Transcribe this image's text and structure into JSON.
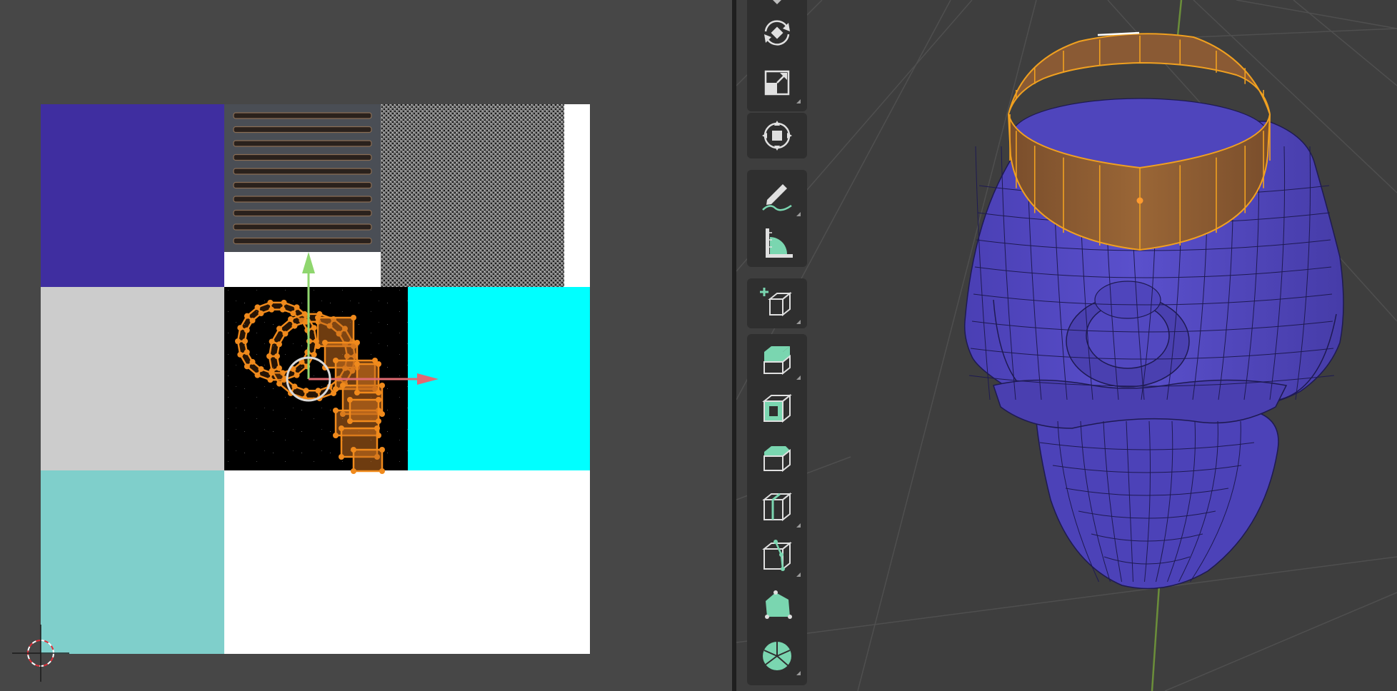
{
  "uv_editor": {
    "background": "#474747",
    "texture_tiles": [
      {
        "name": "uv-tile-purple",
        "color": "#3f2ea0"
      },
      {
        "name": "uv-tile-vent",
        "color": "#4a4e55"
      },
      {
        "name": "uv-tile-noise",
        "color": "#8a8a8a"
      },
      {
        "name": "uv-tile-gray",
        "color": "#cccccc"
      },
      {
        "name": "uv-tile-black",
        "color": "#000000"
      },
      {
        "name": "uv-tile-cyan",
        "color": "#00ffff"
      },
      {
        "name": "uv-tile-teal",
        "color": "#7fcfcb"
      },
      {
        "name": "uv-tile-white",
        "color": "#ffffff"
      }
    ],
    "selection_color": "#f08a1c",
    "gizmo": {
      "x_axis_color": "#e06a72",
      "y_axis_color": "#8fd66e",
      "pivot_color": "#d9d9d9"
    },
    "cursor_icon": "2d-cursor-icon"
  },
  "viewport": {
    "background": "#3e3e3e",
    "mesh_color": "#5248c0",
    "selected_face_color": "#8a5a34",
    "selected_edge_color": "#f0a020",
    "active_edge_color": "#ffffff",
    "origin_color": "#ff9a2e",
    "z_axis_color": "#6b8e3a"
  },
  "toolbar": {
    "accent": "#7ad6b0",
    "groups": [
      {
        "tools": [
          {
            "name": "rotate-tool",
            "icon": "rotate-icon"
          },
          {
            "name": "scale-tool",
            "icon": "scale-icon"
          },
          {
            "name": "transform-tool",
            "icon": "transform-icon"
          }
        ]
      },
      {
        "tools": [
          {
            "name": "annotate-tool",
            "icon": "annotate-icon"
          },
          {
            "name": "measure-tool",
            "icon": "measure-icon"
          }
        ]
      },
      {
        "tools": [
          {
            "name": "add-cube-tool",
            "icon": "add-cube-icon"
          }
        ]
      },
      {
        "tools": [
          {
            "name": "extrude-region-tool",
            "icon": "extrude-region-icon"
          },
          {
            "name": "inset-faces-tool",
            "icon": "inset-faces-icon"
          },
          {
            "name": "bevel-tool",
            "icon": "bevel-icon"
          },
          {
            "name": "loop-cut-tool",
            "icon": "loop-cut-icon"
          },
          {
            "name": "knife-tool",
            "icon": "knife-icon"
          },
          {
            "name": "poly-build-tool",
            "icon": "poly-build-icon"
          },
          {
            "name": "spin-tool",
            "icon": "spin-icon"
          }
        ]
      }
    ]
  }
}
